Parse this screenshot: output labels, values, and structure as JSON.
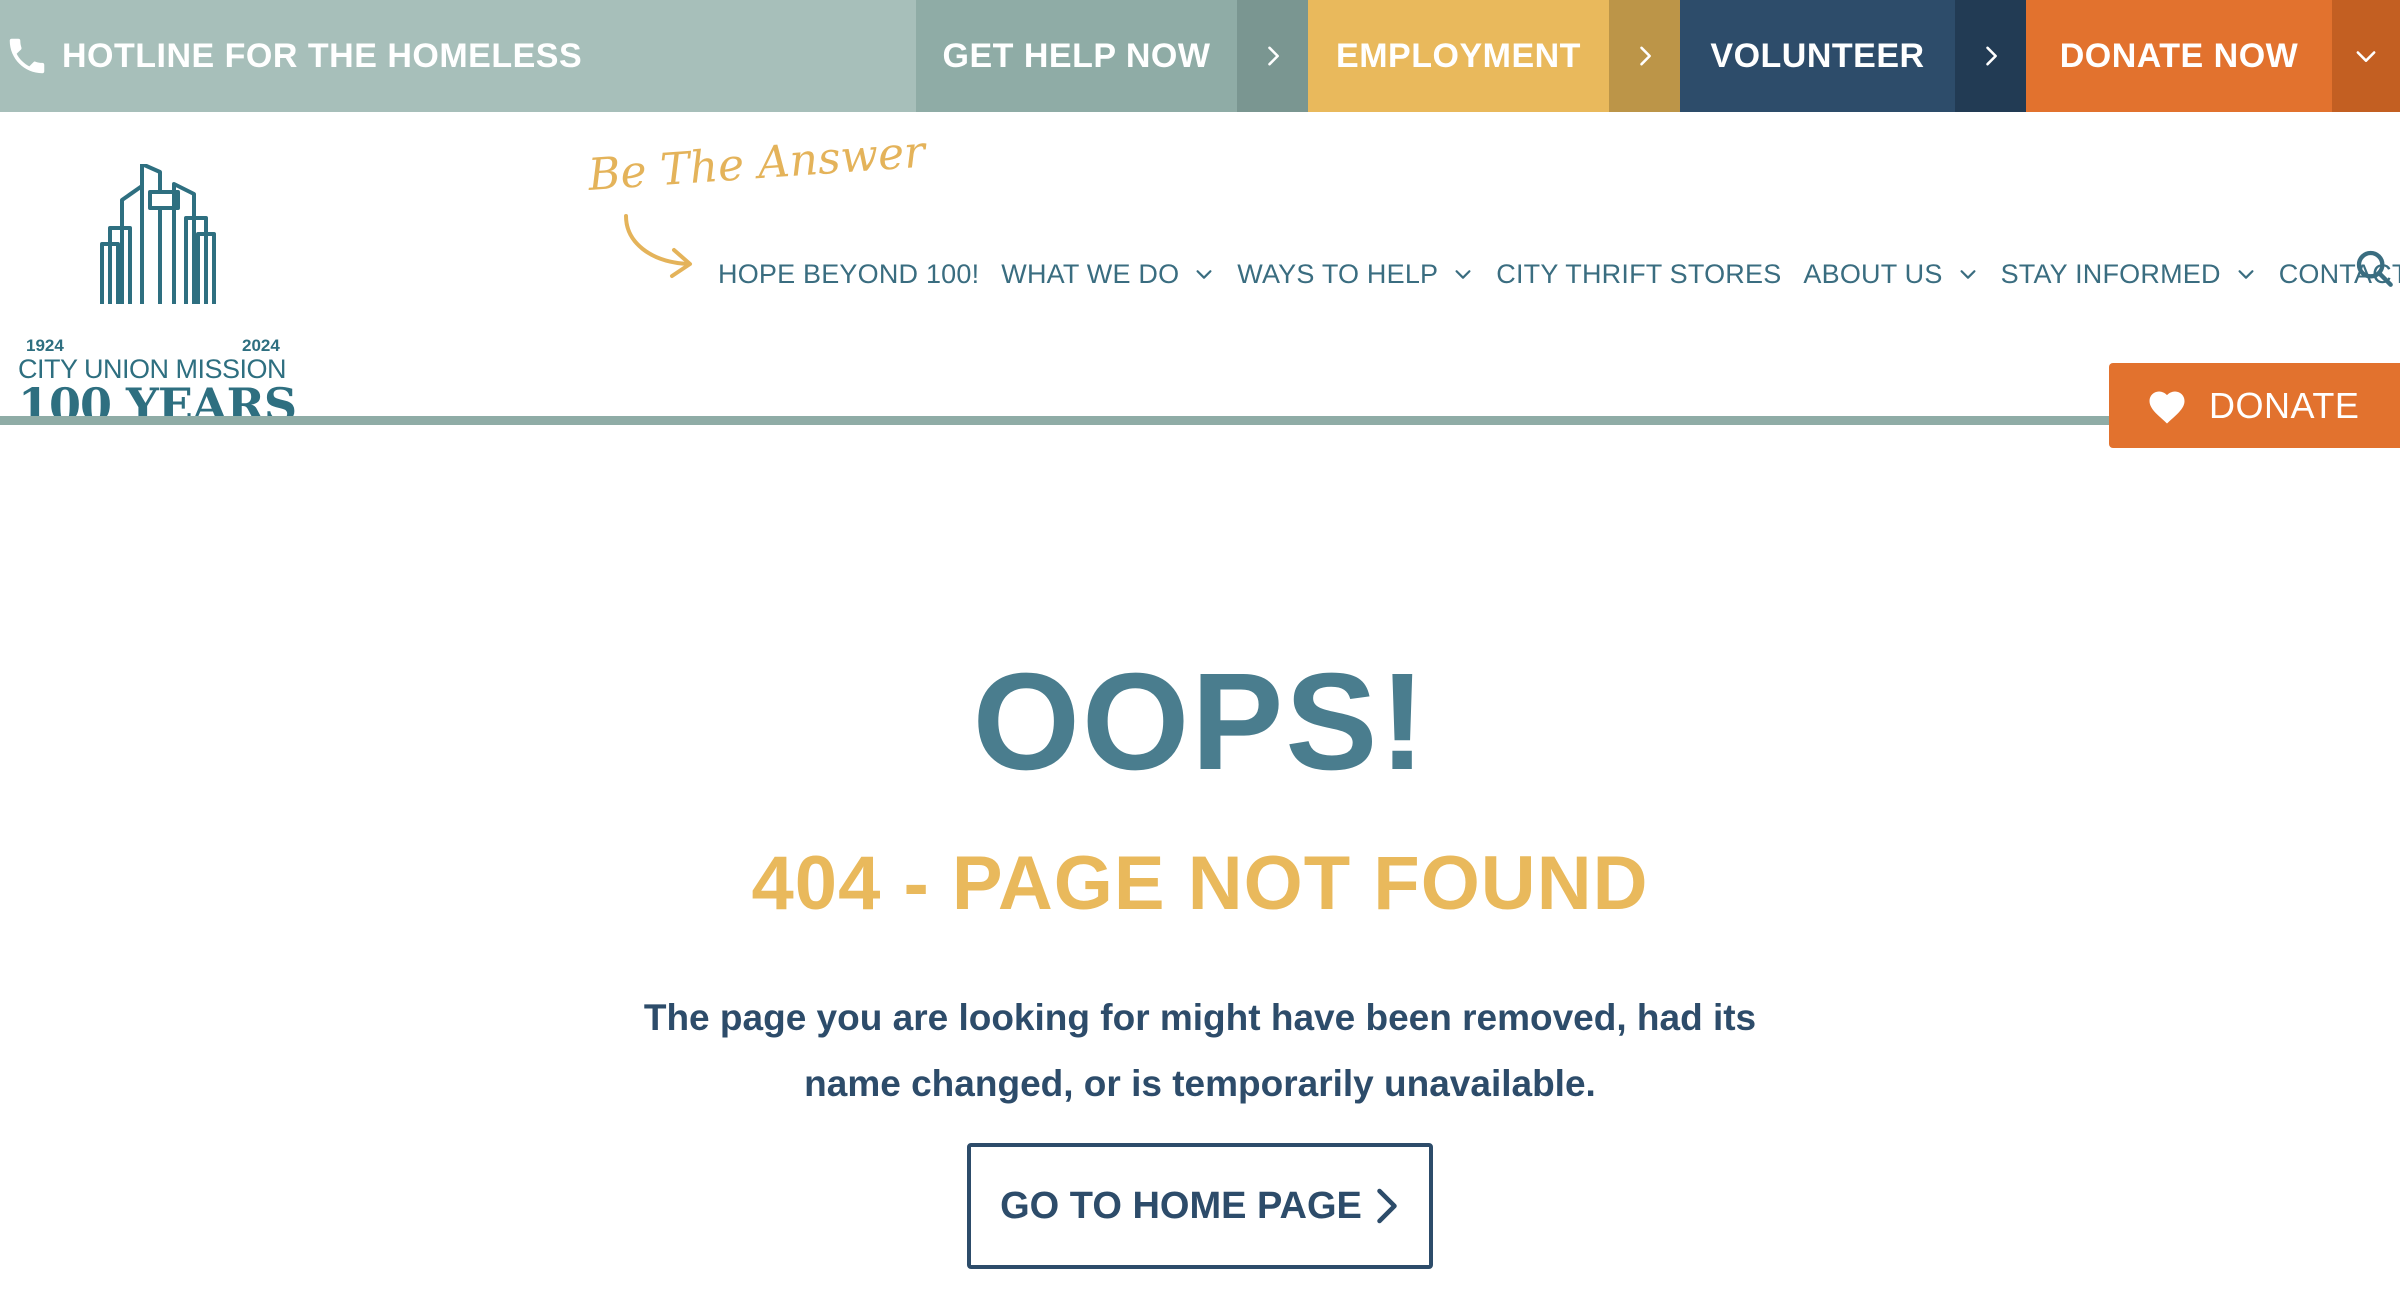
{
  "topbar": {
    "hotline_label": "HOTLINE FOR THE HOMELESS",
    "get_help_label": "GET HELP NOW",
    "employment_label": "EMPLOYMENT",
    "volunteer_label": "VOLUNTEER",
    "donate_label": "DONATE NOW",
    "colors": {
      "hotline": "#a7bfba",
      "get_help": "#8faca6",
      "employment": "#e9b95c",
      "volunteer": "#2d4c6a",
      "donate": "#e2722e"
    }
  },
  "logo": {
    "year_start": "1924",
    "year_end": "2024",
    "name": "CITY UNION MISSION",
    "years": "100 YEARS",
    "icon": "city-skyline-cross-icon"
  },
  "tagline": "Be The Answer",
  "nav": {
    "items": [
      {
        "label": "HOPE BEYOND 100!",
        "has_dropdown": false
      },
      {
        "label": "WHAT WE DO",
        "has_dropdown": true
      },
      {
        "label": "WAYS TO HELP",
        "has_dropdown": true
      },
      {
        "label": "CITY THRIFT STORES",
        "has_dropdown": false
      },
      {
        "label": "ABOUT US",
        "has_dropdown": true
      },
      {
        "label": "STAY INFORMED",
        "has_dropdown": true
      },
      {
        "label": "CONTACT",
        "has_dropdown": false
      }
    ],
    "search_icon": "search-icon"
  },
  "donate_float": {
    "label": "DONATE",
    "icon": "heart-icon"
  },
  "main": {
    "heading": "OOPS!",
    "subheading": "404 - PAGE NOT FOUND",
    "message": "The page you are looking for might have been removed, had its name changed, or is temporarily unavailable.",
    "home_button_label": "GO TO HOME PAGE"
  }
}
